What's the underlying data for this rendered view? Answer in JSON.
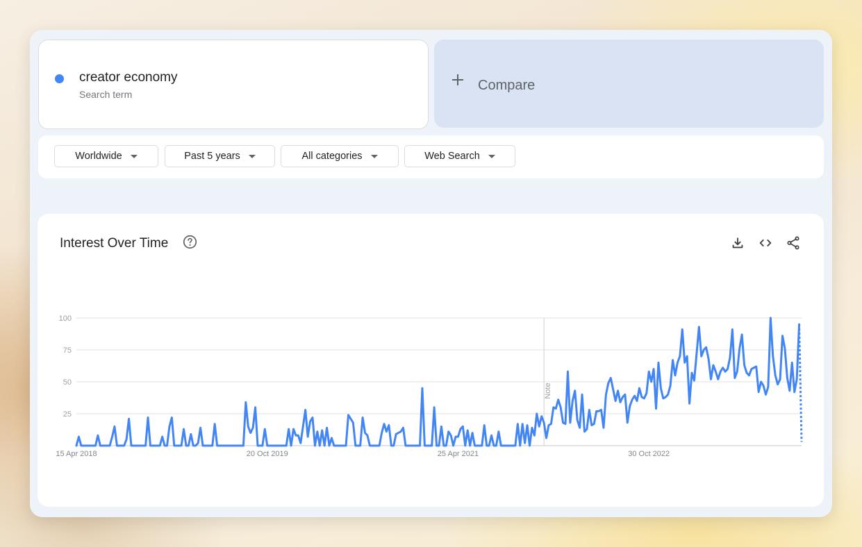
{
  "search_term": {
    "name": "creator economy",
    "sublabel": "Search term",
    "color": "#4285f4"
  },
  "compare": {
    "label": "Compare"
  },
  "filters": [
    {
      "label": "Worldwide"
    },
    {
      "label": "Past 5 years"
    },
    {
      "label": "All categories"
    },
    {
      "label": "Web Search"
    }
  ],
  "chart_card": {
    "title": "Interest Over Time",
    "icons": [
      "help-icon",
      "download-icon",
      "embed-icon",
      "share-icon"
    ]
  },
  "chart_data": {
    "type": "line",
    "series": [
      {
        "name": "creator economy",
        "color": "#4285f4",
        "values": [
          0,
          7,
          0,
          0,
          0,
          0,
          0,
          0,
          0,
          8,
          0,
          0,
          0,
          0,
          0,
          7,
          15,
          0,
          0,
          0,
          0,
          5,
          21,
          0,
          0,
          0,
          0,
          0,
          0,
          0,
          22,
          0,
          0,
          0,
          0,
          0,
          7,
          0,
          0,
          15,
          22,
          0,
          0,
          0,
          0,
          13,
          0,
          0,
          9,
          0,
          0,
          2,
          14,
          0,
          0,
          0,
          0,
          0,
          17,
          0,
          0,
          0,
          0,
          0,
          0,
          0,
          0,
          0,
          0,
          0,
          0,
          34,
          15,
          10,
          14,
          30,
          0,
          0,
          0,
          13,
          0,
          0,
          0,
          0,
          0,
          0,
          0,
          0,
          0,
          13,
          0,
          13,
          8,
          8,
          2,
          15,
          28,
          7,
          19,
          22,
          0,
          11,
          0,
          12,
          0,
          14,
          0,
          6,
          0,
          0,
          0,
          0,
          0,
          0,
          24,
          21,
          18,
          0,
          0,
          0,
          22,
          10,
          8,
          0,
          0,
          0,
          0,
          0,
          10,
          17,
          11,
          16,
          0,
          0,
          9,
          10,
          11,
          14,
          0,
          0,
          0,
          0,
          0,
          0,
          0,
          45,
          0,
          0,
          0,
          0,
          30,
          0,
          0,
          15,
          0,
          0,
          11,
          8,
          0,
          7,
          7,
          13,
          15,
          0,
          12,
          0,
          10,
          0,
          0,
          0,
          0,
          16,
          0,
          0,
          8,
          0,
          0,
          11,
          0,
          0,
          0,
          0,
          0,
          0,
          0,
          17,
          0,
          17,
          2,
          16,
          0,
          14,
          8,
          25,
          15,
          23,
          18,
          6,
          16,
          17,
          30,
          29,
          36,
          30,
          18,
          17,
          58,
          18,
          35,
          43,
          20,
          14,
          40,
          11,
          13,
          28,
          16,
          17,
          27,
          27,
          28,
          14,
          40,
          49,
          53,
          44,
          35,
          43,
          34,
          38,
          40,
          18,
          31,
          36,
          39,
          35,
          45,
          38,
          37,
          41,
          58,
          50,
          60,
          29,
          65,
          45,
          37,
          38,
          40,
          47,
          67,
          55,
          65,
          70,
          91,
          65,
          70,
          33,
          57,
          51,
          72,
          93,
          70,
          75,
          77,
          68,
          52,
          63,
          58,
          52,
          58,
          61,
          58,
          60,
          69,
          91,
          53,
          58,
          76,
          87,
          63,
          57,
          55,
          60,
          61,
          62,
          42,
          50,
          47,
          40,
          46,
          100,
          70,
          55,
          48,
          52,
          86,
          76,
          53,
          43,
          65,
          42,
          52,
          95,
          3
        ]
      }
    ],
    "x_tick_labels": [
      "15 Apr 2018",
      "20 Oct 2019",
      "25 Apr 2021",
      "30 Oct 2022"
    ],
    "x_tick_indices": [
      0,
      80,
      160,
      240
    ],
    "y_ticks": [
      25,
      50,
      75,
      100
    ],
    "ylim": [
      0,
      100
    ],
    "note_label": "Note",
    "note_index": 196,
    "partial_data_last_point": true,
    "grid": true
  }
}
